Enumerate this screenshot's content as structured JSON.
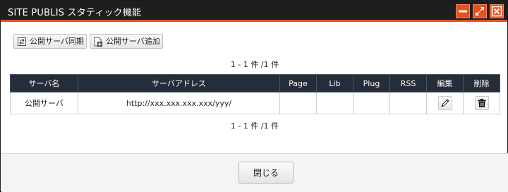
{
  "window": {
    "title": "SITE PUBLIS スタティック機能",
    "accent_color": "#e8501e",
    "titlebar_color": "#1e1e1e",
    "controls": [
      "minimize-icon",
      "maximize-icon",
      "close-icon"
    ]
  },
  "toolbar": {
    "sync_label": "公開サーバ同期",
    "add_label": "公開サーバ追加"
  },
  "pager": {
    "top_text": "1 - 1 件 /1 件",
    "bottom_text": "1 - 1 件 /1 件"
  },
  "table": {
    "header_color": "#262d3a",
    "columns": [
      "サーバ名",
      "サーバアドレス",
      "Page",
      "Lib",
      "Plug",
      "RSS",
      "編集",
      "削除"
    ],
    "rows": [
      {
        "name": "公開サーバ",
        "address": "http://xxx.xxx.xxx.xxx/yyy/",
        "page": "",
        "lib": "",
        "plug": "",
        "rss": "",
        "edit_icon": "pencil-icon",
        "delete_icon": "trash-icon"
      }
    ]
  },
  "footer": {
    "close_label": "閉じる"
  }
}
